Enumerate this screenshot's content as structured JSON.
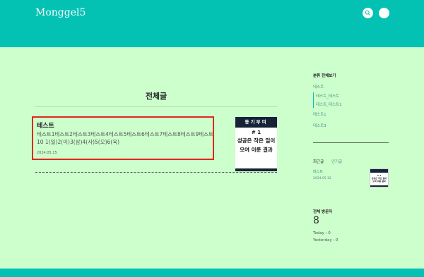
{
  "header": {
    "logo": "Monggel5",
    "search_icon": "search-icon",
    "menu_icon": "menu-icon"
  },
  "main": {
    "title": "전체글",
    "post": {
      "title": "테스트",
      "excerpt": "테스트1테스트2테스트3테스트4테스트5테스트6테스트7테스트8테스트9테스트10 1(일)2(이)3(삼)4(사)5(오)6(육)",
      "date": "2024.05.15",
      "thumbnail": {
        "banner": "동기부여",
        "number": "# 1",
        "line1": "성공은 작은 일이",
        "line2": "모여 이룬 결과"
      }
    }
  },
  "sidebar": {
    "category_heading": "분류 전체보기",
    "categories": [
      "테스트",
      "테스트_테스트",
      "테스트_테스트1",
      "테스트1",
      "테스트3"
    ],
    "tabs": {
      "recent": "최근글",
      "popular": "인기글"
    },
    "recent_post": {
      "title": "테스트",
      "date": "2024.05.15"
    },
    "visitors": {
      "heading": "전체 방문자",
      "total": "8",
      "today": "Today : 0",
      "yesterday": "Yesterday : 0"
    }
  },
  "colors": {
    "header": "#03c2b4",
    "background": "#ccffcc",
    "highlight_border": "#e0281c",
    "thumb_dark": "#152238",
    "link": "#4f8f88"
  }
}
